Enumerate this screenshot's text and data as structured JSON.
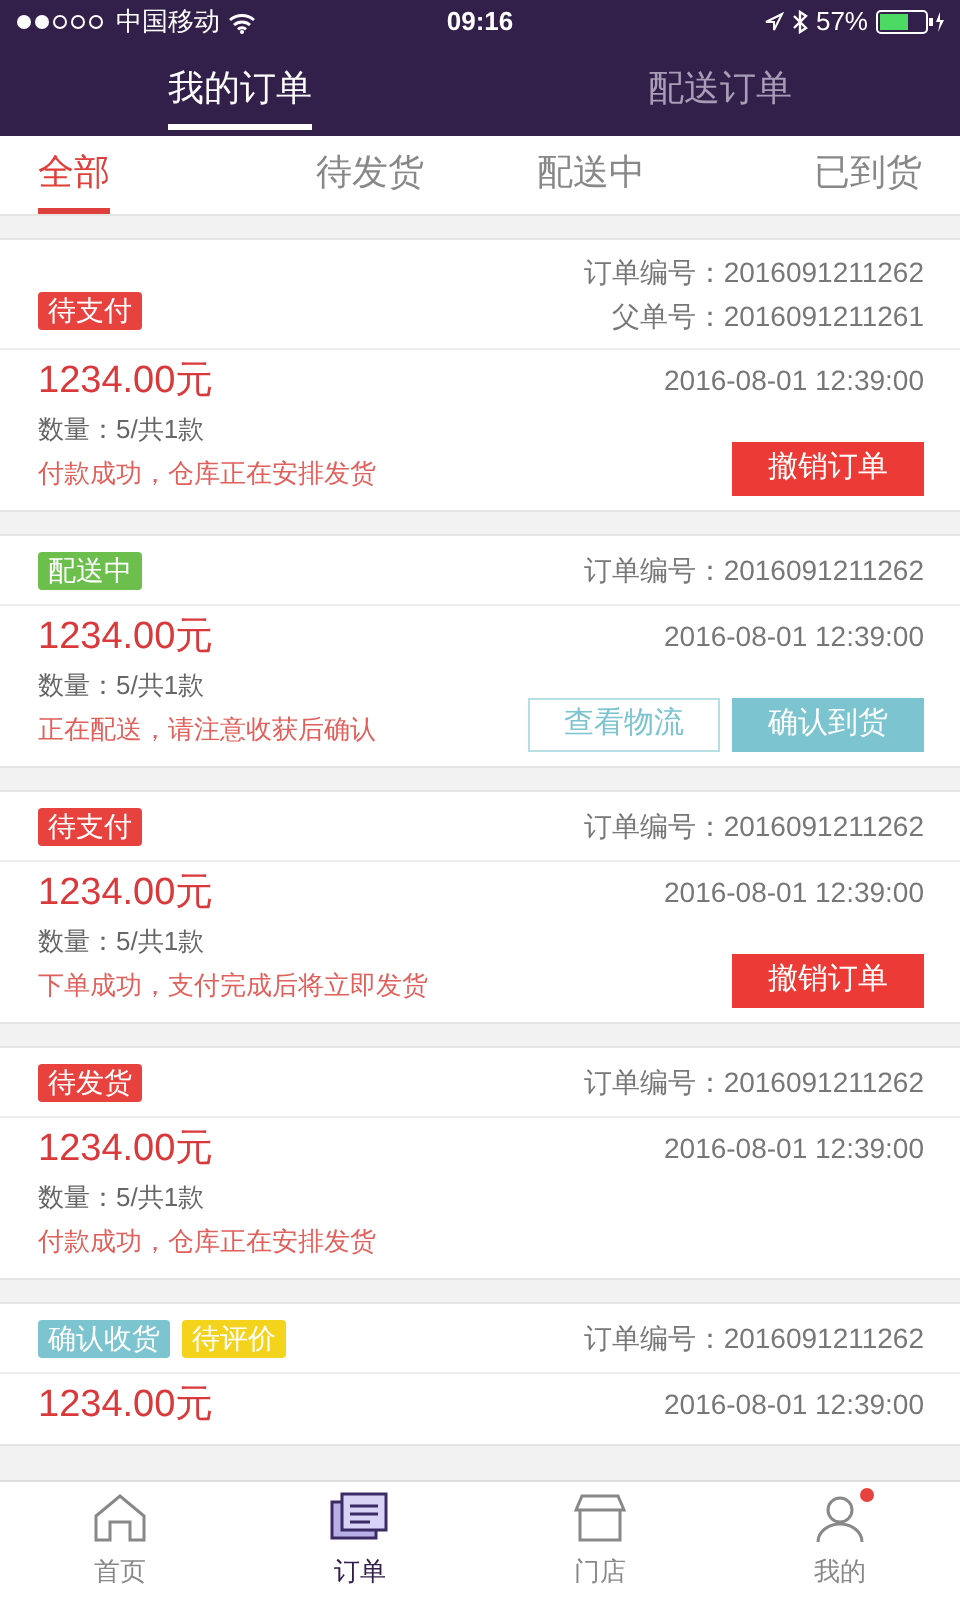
{
  "status_bar": {
    "carrier": "中国移动",
    "time": "09:16",
    "battery": "57%"
  },
  "header_tabs": [
    {
      "label": "我的订单",
      "selected": true
    },
    {
      "label": "配送订单",
      "selected": false
    }
  ],
  "filter_tabs": [
    {
      "label": "全部",
      "selected": true
    },
    {
      "label": "待发货",
      "selected": false
    },
    {
      "label": "配送中",
      "selected": false
    },
    {
      "label": "已到货",
      "selected": false
    }
  ],
  "orders": [
    {
      "tags": [
        {
          "label": "待支付",
          "color": "#e8423f"
        }
      ],
      "order_no": "订单编号：2016091211262",
      "parent_no": "父单号：2016091211261",
      "price": "1234.00元",
      "date": "2016-08-01 12:39:00",
      "quantity": "数量：5/共1款",
      "message": "付款成功，仓库正在安排发货",
      "buttons": [
        {
          "label": "撤销订单",
          "kind": "red"
        }
      ]
    },
    {
      "tags": [
        {
          "label": "配送中",
          "color": "#6cbf4c"
        }
      ],
      "order_no": "订单编号：2016091211262",
      "price": "1234.00元",
      "date": "2016-08-01 12:39:00",
      "quantity": "数量：5/共1款",
      "message": "正在配送，请注意收获后确认",
      "buttons": [
        {
          "label": "查看物流",
          "kind": "outline"
        },
        {
          "label": "确认到货",
          "kind": "teal"
        }
      ]
    },
    {
      "tags": [
        {
          "label": "待支付",
          "color": "#e8423f"
        }
      ],
      "order_no": "订单编号：2016091211262",
      "price": "1234.00元",
      "date": "2016-08-01 12:39:00",
      "quantity": "数量：5/共1款",
      "message": "下单成功，支付完成后将立即发货",
      "buttons": [
        {
          "label": "撤销订单",
          "kind": "red"
        }
      ]
    },
    {
      "tags": [
        {
          "label": "待发货",
          "color": "#e8423f"
        }
      ],
      "order_no": "订单编号：2016091211262",
      "price": "1234.00元",
      "date": "2016-08-01 12:39:00",
      "quantity": "数量：5/共1款",
      "message": "付款成功，仓库正在安排发货"
    },
    {
      "tags": [
        {
          "label": "确认收货",
          "color": "#7cc4cf"
        },
        {
          "label": "待评价",
          "color": "#f3d31c"
        }
      ],
      "order_no": "订单编号：2016091211262",
      "price": "1234.00元",
      "date": "2016-08-01 12:39:00"
    }
  ],
  "tab_bar": [
    {
      "label": "首页",
      "selected": false
    },
    {
      "label": "订单",
      "selected": true
    },
    {
      "label": "门店",
      "selected": false
    },
    {
      "label": "我的",
      "selected": false,
      "badge": true
    }
  ]
}
